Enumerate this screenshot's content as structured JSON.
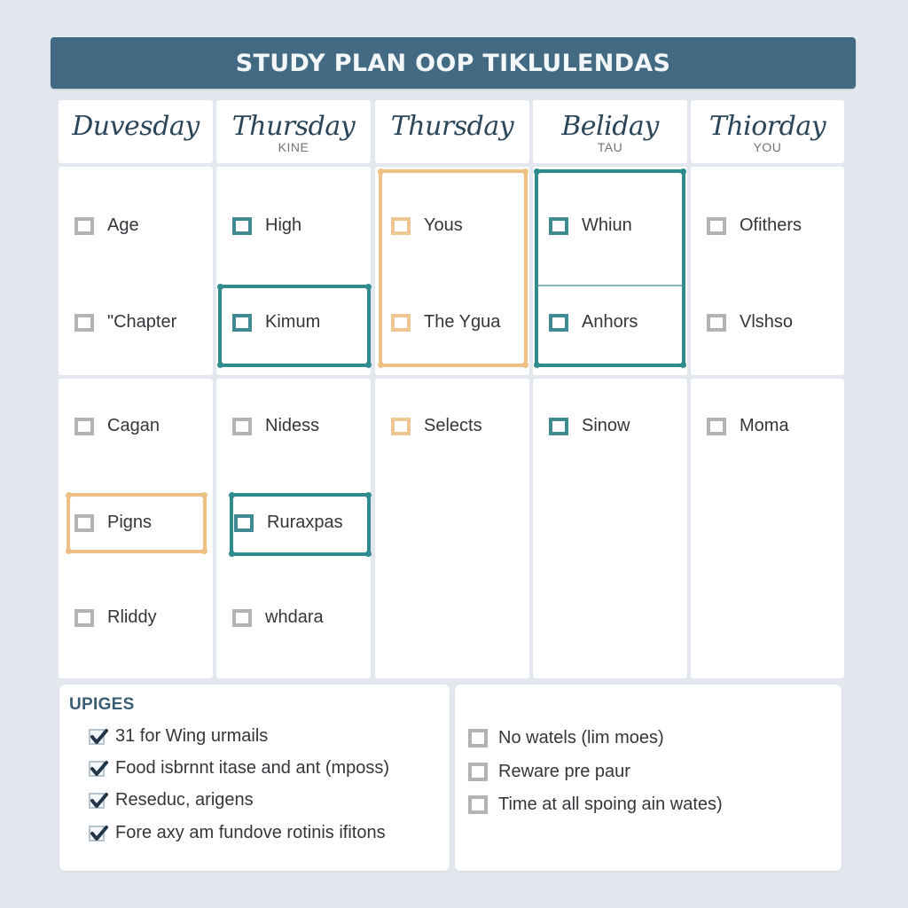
{
  "header": {
    "title": "STUDY PLAN OOP TIKLULENDAS"
  },
  "colors": {
    "title_bar": "#426b83",
    "teal_accent": "#2f8b8e",
    "orange_accent": "#efc083",
    "unchecked_gray": "#b3b3b3",
    "background": "#e3e8ef"
  },
  "days": [
    {
      "name": "Duvesday",
      "subtitle": "",
      "top_tasks": [
        {
          "label": "Age",
          "style": "gray"
        },
        {
          "label": "\"Chapter",
          "style": "gray"
        }
      ],
      "bottom_tasks": [
        {
          "label": "Cagan",
          "style": "gray"
        },
        {
          "label": "Pigns",
          "style": "gray",
          "highlight": "orange"
        },
        {
          "label": "Rliddy",
          "style": "gray"
        }
      ]
    },
    {
      "name": "Thursday",
      "subtitle": "KINE",
      "top_tasks": [
        {
          "label": "High",
          "style": "teal"
        },
        {
          "label": "Kimum",
          "style": "teal",
          "highlight": "teal"
        }
      ],
      "bottom_tasks": [
        {
          "label": "Nidess",
          "style": "gray"
        },
        {
          "label": "Ruraxpas",
          "style": "teal",
          "highlight": "teal"
        },
        {
          "label": "whdara",
          "style": "gray"
        }
      ]
    },
    {
      "name": "Thursday",
      "subtitle": "",
      "top_tasks": [
        {
          "label": "Yous",
          "style": "orange"
        },
        {
          "label": "The Ygua",
          "style": "orange"
        }
      ],
      "top_highlight": "orange",
      "bottom_tasks": [
        {
          "label": "Selects",
          "style": "orange"
        }
      ]
    },
    {
      "name": "Beliday",
      "subtitle": "TAU",
      "top_tasks": [
        {
          "label": "Whiun",
          "style": "teal"
        },
        {
          "label": "Anhors",
          "style": "teal"
        }
      ],
      "top_highlight": "teal",
      "bottom_tasks": [
        {
          "label": "Sinow",
          "style": "teal"
        }
      ]
    },
    {
      "name": "Thiorday",
      "subtitle": "YOU",
      "top_tasks": [
        {
          "label": "Ofithers",
          "style": "gray"
        },
        {
          "label": "Vlshso",
          "style": "gray"
        }
      ],
      "bottom_tasks": [
        {
          "label": "Moma",
          "style": "gray"
        }
      ]
    }
  ],
  "updates_panel": {
    "title": "UPIGES",
    "items": [
      {
        "label": "31 for Wing urmails",
        "checked": true
      },
      {
        "label": "Food isbrnnt itase and ant (mposs)",
        "checked": true
      },
      {
        "label": "Reseduc, arigens",
        "checked": true
      },
      {
        "label": "Fore axy am fundove rotinis ifitons",
        "checked": true
      }
    ]
  },
  "pending_panel": {
    "items": [
      {
        "label": "No watels (lim moes)",
        "checked": false
      },
      {
        "label": "Reware pre paur",
        "checked": false
      },
      {
        "label": "Time at all spoing ain wates)",
        "checked": false
      }
    ]
  }
}
